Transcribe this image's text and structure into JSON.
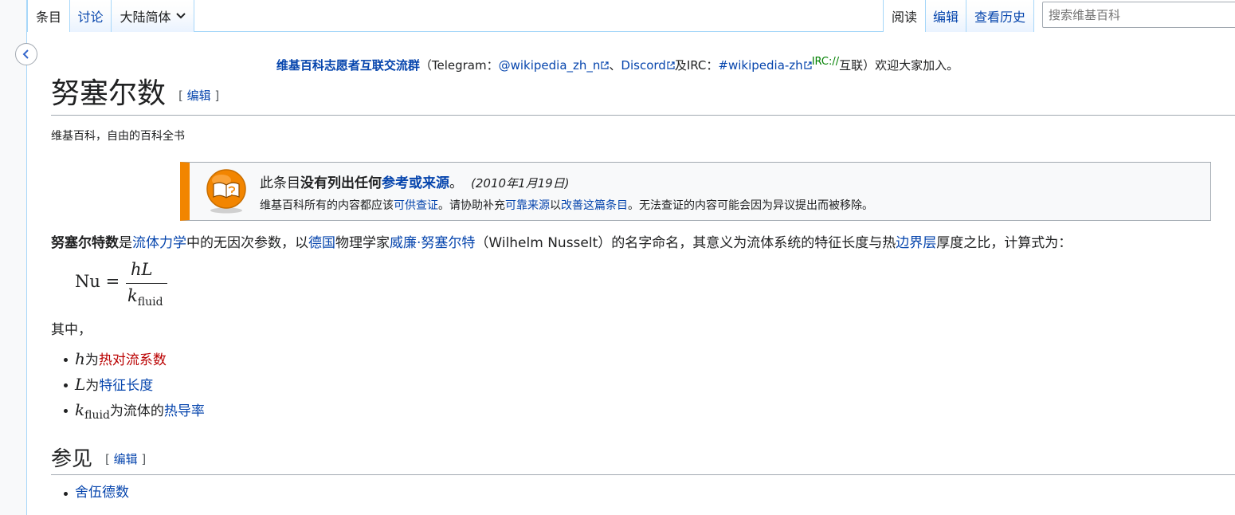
{
  "tabs": {
    "article": "条目",
    "talk": "讨论",
    "variant": "大陆简体",
    "read": "阅读",
    "edit": "编辑",
    "history": "查看历史"
  },
  "search": {
    "placeholder": "搜索维基百科"
  },
  "sitenotice": {
    "group": "维基百科志愿者互联交流群",
    "open": "（Telegram：",
    "telegram": "@wikipedia_zh_n",
    "sep1": "、",
    "discord": "Discord",
    "and": "及IRC：",
    "irc": "#wikipedia-zh",
    "irc_label": "IRC://",
    "close": "互联）欢迎大家加入。"
  },
  "page": {
    "title": "努塞尔数",
    "edit_label": "编辑",
    "tagline": "维基百科，自由的百科全书"
  },
  "ambox": {
    "pre": "此条目",
    "bold": "没有列出任何",
    "link": "参考或来源",
    "end": "。",
    "date": "(2010年1月19日)",
    "l2_a": "维基百科所有的内容都应该",
    "l2_link1": "可供查证",
    "l2_b": "。请协助补充",
    "l2_link2": "可靠来源",
    "l2_c": "以",
    "l2_link3": "改善这篇条目",
    "l2_d": "。无法查证的内容可能会因为异议提出而被移除。"
  },
  "intro": {
    "bold": "努塞尔特数",
    "t1": "是",
    "l1": "流体力学",
    "t2": "中的无因次参数，以",
    "l2": "德国",
    "t3": "物理学家",
    "l3": "威廉·努塞尔特",
    "t4": "（Wilhelm Nusselt）的名字命名，其意义为流体系统的特征长度与热",
    "l4": "边界层",
    "t5": "厚度之比，计算式为："
  },
  "formula": {
    "lhs": "Nu",
    "eq": "=",
    "num": "hL",
    "den": "k",
    "den_sub": "fluid"
  },
  "where": "其中，",
  "vars": [
    {
      "sym": "h",
      "text": "为",
      "link": "热对流系数"
    },
    {
      "sym": "L",
      "text": "为",
      "link": "特征长度"
    },
    {
      "sym": "k",
      "sub": "fluid",
      "text": "为流体的",
      "link": "热导率"
    }
  ],
  "see_also": {
    "title": "参见",
    "edit_label": "编辑",
    "items": [
      "舍伍德数"
    ]
  }
}
